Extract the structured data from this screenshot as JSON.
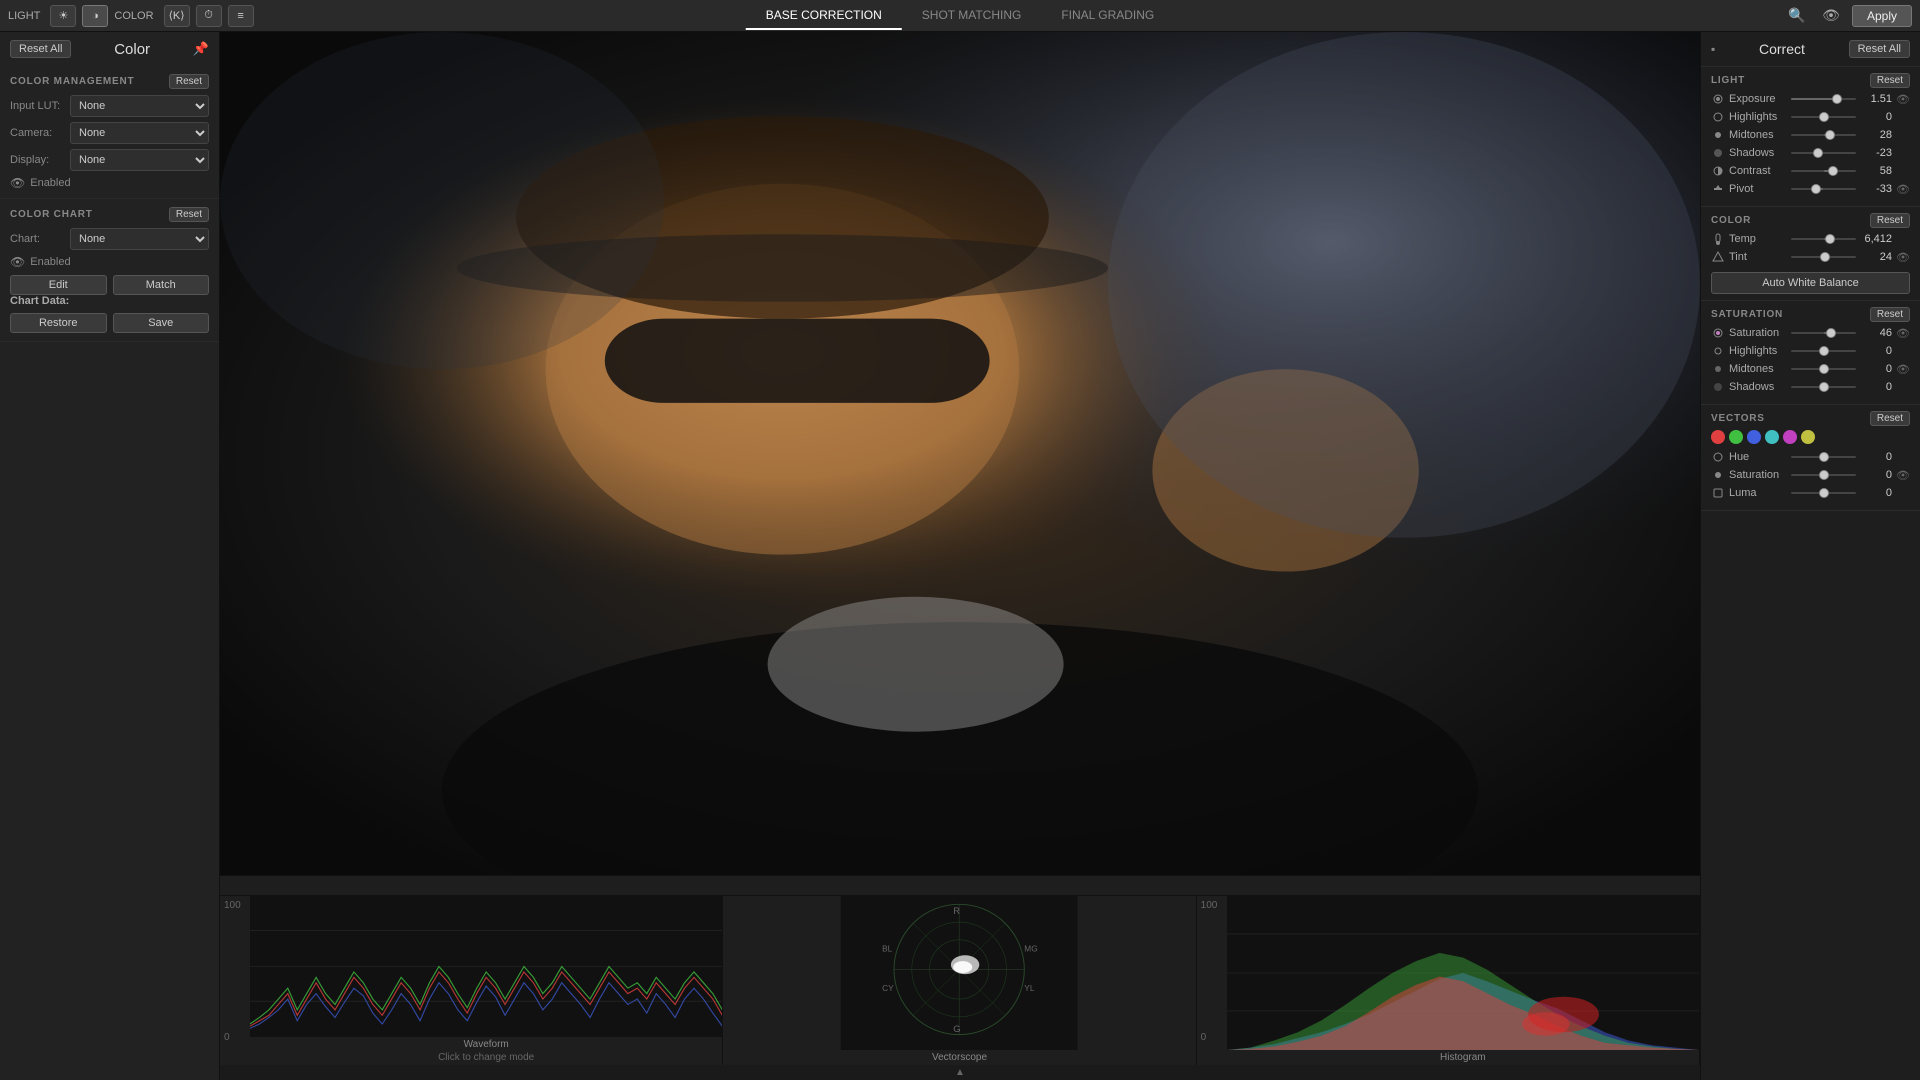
{
  "topbar": {
    "label_light": "LIGHT",
    "label_color": "COLOR",
    "tabs": [
      {
        "id": "base-correction",
        "label": "BASE CORRECTION",
        "active": true
      },
      {
        "id": "shot-matching",
        "label": "SHOT MATCHING",
        "active": false
      },
      {
        "id": "final-grading",
        "label": "FINAL GRADING",
        "active": false
      }
    ],
    "apply_label": "Apply"
  },
  "left_panel": {
    "reset_all_label": "Reset All",
    "color_title": "Color",
    "color_management": {
      "title": "COLOR MANAGEMENT",
      "reset_label": "Reset",
      "input_lut_label": "Input LUT:",
      "input_lut_value": "None",
      "camera_label": "Camera:",
      "camera_value": "None",
      "display_label": "Display:",
      "display_value": "None",
      "enabled_label": "Enabled"
    },
    "color_chart": {
      "title": "COLOR CHART",
      "reset_label": "Reset",
      "chart_label": "Chart:",
      "chart_value": "None",
      "enabled_label": "Enabled",
      "edit_label": "Edit",
      "match_label": "Match",
      "chart_data_label": "Chart Data:",
      "restore_label": "Restore",
      "save_label": "Save"
    }
  },
  "right_panel": {
    "title": "Correct",
    "reset_all_label": "Reset All",
    "light_section": {
      "title": "LIGHT",
      "reset_label": "Reset",
      "sliders": [
        {
          "id": "exposure",
          "label": "Exposure",
          "value": 1.51,
          "percent": 70,
          "has_eye": true
        },
        {
          "id": "highlights",
          "label": "Highlights",
          "value": 0,
          "percent": 50,
          "has_eye": false
        },
        {
          "id": "midtones",
          "label": "Midtones",
          "value": 28,
          "percent": 60,
          "has_eye": false
        },
        {
          "id": "shadows",
          "label": "Shadows",
          "value": -23,
          "percent": 42,
          "has_eye": false
        },
        {
          "id": "contrast",
          "label": "Contrast",
          "value": 58,
          "percent": 65,
          "has_eye": false
        },
        {
          "id": "pivot",
          "label": "Pivot",
          "value": -33,
          "percent": 38,
          "has_eye": true
        }
      ]
    },
    "color_section": {
      "title": "COLOR",
      "reset_label": "Reset",
      "sliders": [
        {
          "id": "temp",
          "label": "Temp",
          "value": "6,412",
          "percent": 60,
          "has_eye": false
        },
        {
          "id": "tint",
          "label": "Tint",
          "value": 24,
          "percent": 53,
          "has_eye": true
        }
      ],
      "auto_wb_label": "Auto White Balance"
    },
    "saturation_section": {
      "title": "SATURATION",
      "reset_label": "Reset",
      "sliders": [
        {
          "id": "saturation",
          "label": "Saturation",
          "value": 46,
          "percent": 62,
          "has_eye": true
        },
        {
          "id": "highlights",
          "label": "Highlights",
          "value": 0,
          "percent": 50,
          "has_eye": false
        },
        {
          "id": "midtones",
          "label": "Midtones",
          "value": 0,
          "percent": 50,
          "has_eye": false
        },
        {
          "id": "shadows",
          "label": "Shadows",
          "value": 0,
          "percent": 50,
          "has_eye": true
        }
      ]
    },
    "vectors_section": {
      "title": "VECTORS",
      "reset_label": "Reset",
      "colors": [
        {
          "id": "red",
          "hex": "#e04040"
        },
        {
          "id": "green",
          "hex": "#40c040"
        },
        {
          "id": "blue",
          "hex": "#4060e0"
        },
        {
          "id": "cyan",
          "hex": "#40c0c0"
        },
        {
          "id": "magenta",
          "hex": "#c040c0"
        },
        {
          "id": "yellow",
          "hex": "#c0c040"
        }
      ],
      "sliders": [
        {
          "id": "hue",
          "label": "Hue",
          "value": 0,
          "percent": 50,
          "has_eye": false
        },
        {
          "id": "saturation",
          "label": "Saturation",
          "value": 0,
          "percent": 50,
          "has_eye": true
        },
        {
          "id": "luma",
          "label": "Luma",
          "value": 0,
          "percent": 50,
          "has_eye": false
        }
      ]
    }
  },
  "scopes": {
    "waveform_label": "Waveform",
    "waveform_sublabel": "Click to change mode",
    "vectorscope_label": "Vectorscope",
    "histogram_label": "Histogram",
    "y_high": "100",
    "y_low": "0"
  }
}
